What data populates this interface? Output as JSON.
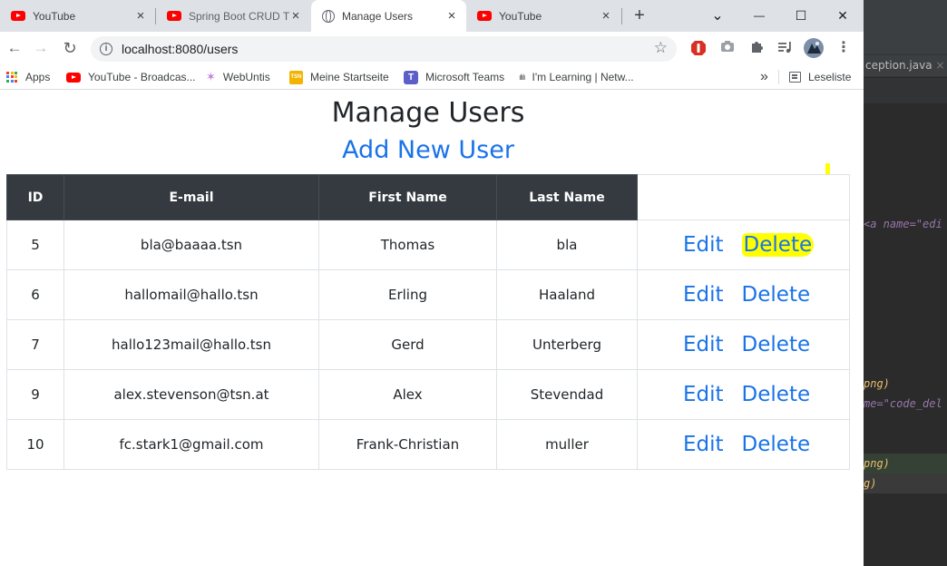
{
  "browser": {
    "tabs": [
      {
        "title": "YouTube",
        "icon": "youtube-icon",
        "active": false
      },
      {
        "title": "Spring Boot CRUD T",
        "icon": "youtube-icon",
        "active": false
      },
      {
        "title": "Manage Users",
        "icon": "globe-icon",
        "active": true
      },
      {
        "title": "YouTube",
        "icon": "youtube-icon",
        "active": false
      }
    ],
    "new_tab": "+",
    "window_controls": {
      "chevron": "⌄",
      "minimize": "—",
      "maximize": "☐",
      "close": "✕"
    },
    "url": "localhost:8080/users",
    "bookmarks": [
      {
        "label": "Apps",
        "icon": "apps-icon"
      },
      {
        "label": "YouTube - Broadcas...",
        "icon": "youtube-icon"
      },
      {
        "label": "WebUntis",
        "icon": "webuntis-icon"
      },
      {
        "label": "Meine Startseite",
        "icon": "tsn-icon"
      },
      {
        "label": "Microsoft Teams",
        "icon": "teams-icon"
      },
      {
        "label": "I'm Learning | Netw...",
        "icon": "cisco-icon"
      }
    ],
    "bookmarks_overflow": "»",
    "reading_list": "Leseliste"
  },
  "page": {
    "title": "Manage Users",
    "add_link": "Add New User",
    "columns": [
      "ID",
      "E-mail",
      "First Name",
      "Last Name"
    ],
    "rows": [
      {
        "id": "5",
        "email": "bla@baaaa.tsn",
        "first": "Thomas",
        "last": "bla",
        "edit": "Edit",
        "delete": "Delete"
      },
      {
        "id": "6",
        "email": "hallomail@hallo.tsn",
        "first": "Erling",
        "last": "Haaland",
        "edit": "Edit",
        "delete": "Delete"
      },
      {
        "id": "7",
        "email": "hallo123mail@hallo.tsn",
        "first": "Gerd",
        "last": "Unterberg",
        "edit": "Edit",
        "delete": "Delete"
      },
      {
        "id": "9",
        "email": "alex.stevenson@tsn.at",
        "first": "Alex",
        "last": "Stevendad",
        "edit": "Edit",
        "delete": "Delete"
      },
      {
        "id": "10",
        "email": "fc.stark1@gmail.com",
        "first": "Frank-Christian",
        "last": "muller",
        "edit": "Edit",
        "delete": "Delete"
      }
    ],
    "highlighted_action": "Delete"
  },
  "ide": {
    "tab_label": "ception.java",
    "code_lines": [
      "<a name=\"edi",
      "png)",
      "me=\"code_del",
      "png)",
      "g)"
    ]
  },
  "colors": {
    "link": "#1a73e8",
    "table_header": "#343a40",
    "highlight": "#ffff00"
  }
}
